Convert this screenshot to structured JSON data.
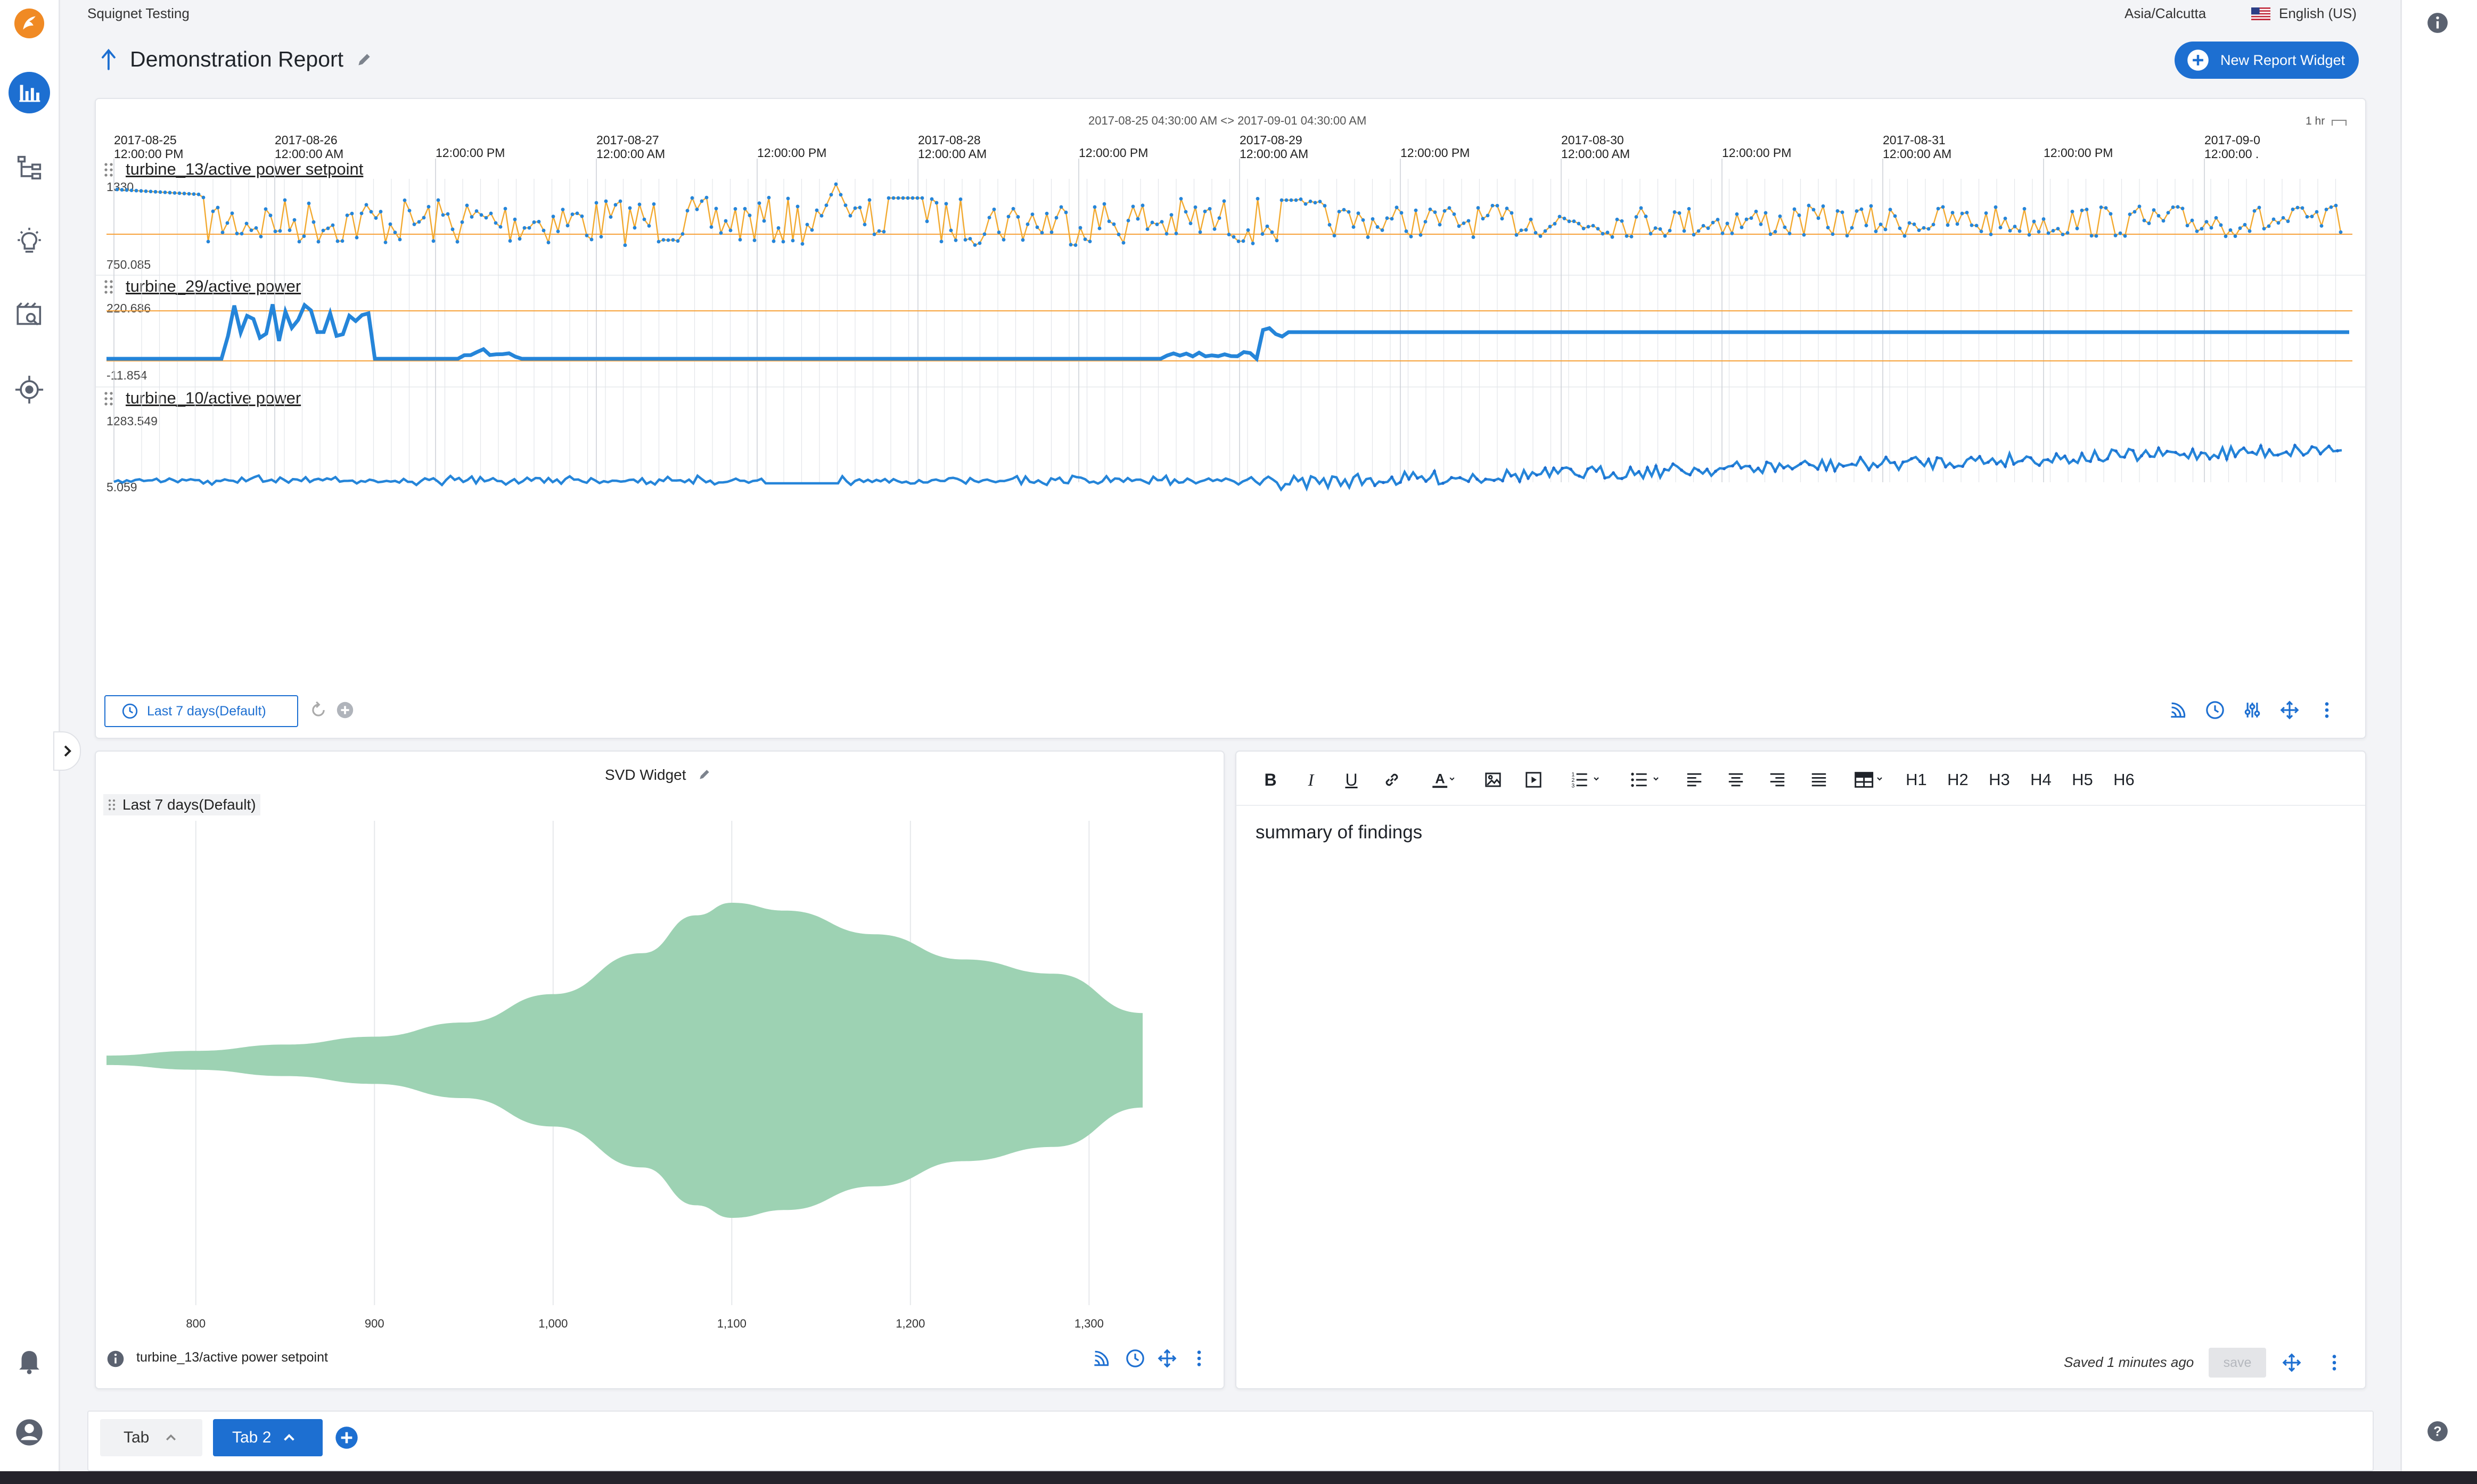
{
  "app": {
    "org_name": "Squignet Testing",
    "timezone": "Asia/Calcutta",
    "language": "English (US)"
  },
  "page": {
    "title": "Demonstration Report",
    "new_widget_label": "New Report Widget"
  },
  "trend_widget": {
    "range_text": "2017-08-25 04:30:00 AM <> 2017-09-01 04:30:00 AM",
    "zoom_text": "1 hr",
    "time_ticks": [
      {
        "date": "2017-08-25",
        "time": "12:00:00 PM"
      },
      {
        "date": "2017-08-26",
        "time": "12:00:00 AM"
      },
      {
        "date": "",
        "time": "12:00:00 PM"
      },
      {
        "date": "2017-08-27",
        "time": "12:00:00 AM"
      },
      {
        "date": "",
        "time": "12:00:00 PM"
      },
      {
        "date": "2017-08-28",
        "time": "12:00:00 AM"
      },
      {
        "date": "",
        "time": "12:00:00 PM"
      },
      {
        "date": "2017-08-29",
        "time": "12:00:00 AM"
      },
      {
        "date": "",
        "time": "12:00:00 PM"
      },
      {
        "date": "2017-08-30",
        "time": "12:00:00 AM"
      },
      {
        "date": "",
        "time": "12:00:00 PM"
      },
      {
        "date": "2017-08-31",
        "time": "12:00:00 AM"
      },
      {
        "date": "",
        "time": "12:00:00 PM"
      },
      {
        "date": "2017-09-0",
        "time": "12:00:00 ."
      }
    ],
    "lanes": [
      {
        "label": "turbine_13/active power setpoint",
        "max": "1330",
        "min": "750.085"
      },
      {
        "label": "turbine_29/active power",
        "max": "220.686",
        "min": "-11.854"
      },
      {
        "label": "turbine_10/active power",
        "max": "1283.549",
        "min": "5.059"
      }
    ],
    "time_range_button": "Last 7 days(Default)"
  },
  "svd_widget": {
    "title": "SVD Widget",
    "range_label": "Last 7 days(Default)",
    "footer_signal": "turbine_13/active power setpoint",
    "chart_data": {
      "type": "violin",
      "series_name": "turbine_13/active power setpoint",
      "x_ticks": [
        "800",
        "900",
        "1,000",
        "1,100",
        "1,200",
        "1,300"
      ],
      "x_tick_values": [
        800,
        900,
        1000,
        1100,
        1200,
        1300
      ],
      "xlim": [
        750,
        1330
      ],
      "color": "#9dd2b3",
      "density_profile": [
        {
          "x": 750,
          "half_width": 0.03
        },
        {
          "x": 800,
          "half_width": 0.06
        },
        {
          "x": 850,
          "half_width": 0.1
        },
        {
          "x": 900,
          "half_width": 0.15
        },
        {
          "x": 950,
          "half_width": 0.24
        },
        {
          "x": 1000,
          "half_width": 0.42
        },
        {
          "x": 1050,
          "half_width": 0.68
        },
        {
          "x": 1080,
          "half_width": 0.92
        },
        {
          "x": 1100,
          "half_width": 1.0
        },
        {
          "x": 1130,
          "half_width": 0.95
        },
        {
          "x": 1180,
          "half_width": 0.8
        },
        {
          "x": 1230,
          "half_width": 0.64
        },
        {
          "x": 1280,
          "half_width": 0.55
        },
        {
          "x": 1330,
          "half_width": 0.3
        }
      ]
    }
  },
  "editor_widget": {
    "toolbar": [
      "B",
      "I",
      "U",
      "H1",
      "H2",
      "H3",
      "H4",
      "H5",
      "H6"
    ],
    "content": "summary of findings",
    "saved_status": "Saved 1 minutes ago",
    "save_label": "save"
  },
  "tabs": [
    {
      "label": "Tab",
      "active": false
    },
    {
      "label": "Tab 2",
      "active": true
    }
  ],
  "colors": {
    "primary": "#1d6fd1",
    "series": "#2585d9",
    "threshold": "#f7a23b",
    "violin": "#9dd2b3"
  }
}
